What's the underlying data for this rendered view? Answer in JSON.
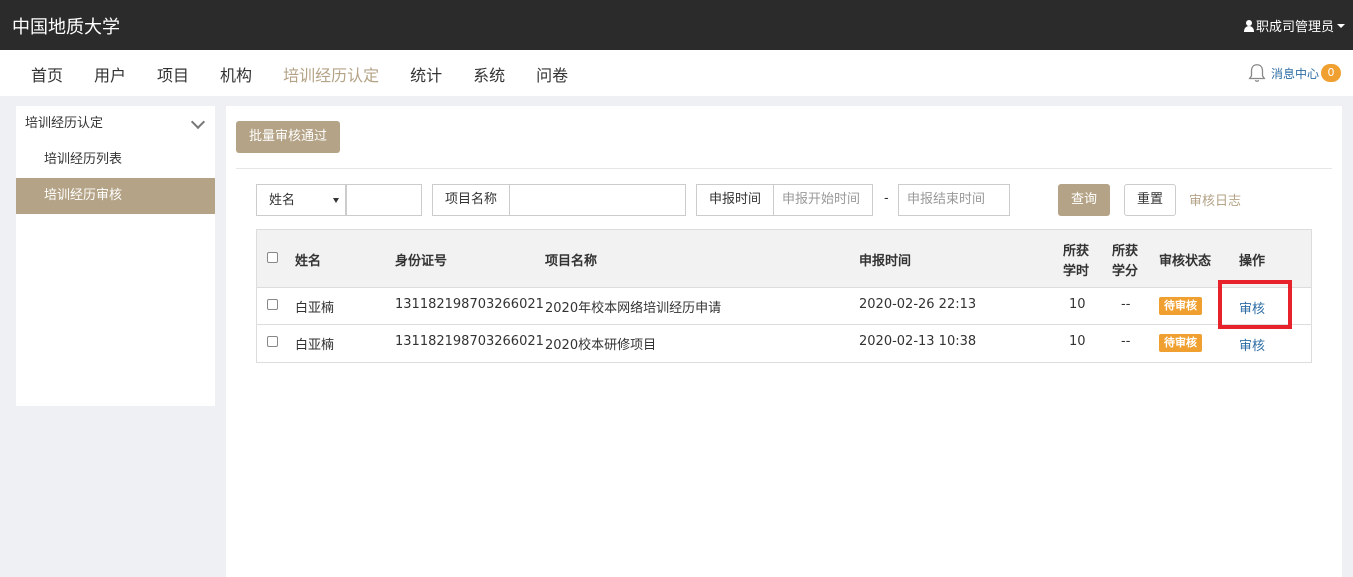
{
  "header": {
    "brand": "中国地质大学",
    "user": "职成司管理员"
  },
  "nav": {
    "items": [
      "首页",
      "用户",
      "项目",
      "机构",
      "培训经历认定",
      "统计",
      "系统",
      "问卷"
    ],
    "active_index": 4,
    "message_label": "消息中心",
    "message_count": "0"
  },
  "sidebar": {
    "section": "培训经历认定",
    "items": [
      "培训经历列表",
      "培训经历审核"
    ],
    "active_index": 1
  },
  "toolbar": {
    "batch_button": "批量审核通过"
  },
  "filters": {
    "select_value": "姓名",
    "project_label": "项目名称",
    "date_label": "申报时间",
    "start_placeholder": "申报开始时间",
    "end_placeholder": "申报结束时间",
    "dash": "-",
    "query_button": "查询",
    "reset_button": "重置",
    "log_link": "审核日志"
  },
  "table": {
    "headers": {
      "name": "姓名",
      "id": "身份证号",
      "project": "项目名称",
      "time": "申报时间",
      "hours1": "所获",
      "hours2": "学时",
      "credit1": "所获",
      "credit2": "学分",
      "status": "审核状态",
      "op": "操作"
    },
    "rows": [
      {
        "name": "白亚楠",
        "id": "131182198703266021",
        "project": "2020年校本网络培训经历申请",
        "time": "2020-02-26 22:13",
        "hours": "10",
        "credit": "--",
        "status": "待审核",
        "op": "审核"
      },
      {
        "name": "白亚楠",
        "id": "131182198703266021",
        "project": "2020校本研修项目",
        "time": "2020-02-13 10:38",
        "hours": "10",
        "credit": "--",
        "status": "待审核",
        "op": "审核"
      }
    ]
  },
  "colors": {
    "accent": "#b4a386",
    "topbar": "#2b2b2b",
    "status_badge": "#f0a030",
    "link": "#2e6da4",
    "highlight_box": "#e8222a"
  }
}
